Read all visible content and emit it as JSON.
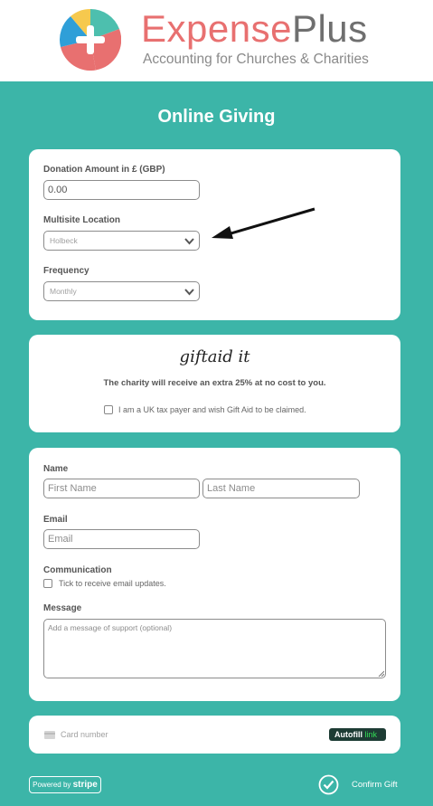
{
  "header": {
    "brand_part1": "Expense",
    "brand_part2": "Plus",
    "tagline": "Accounting for Churches & Charities"
  },
  "page_title": "Online Giving",
  "donation": {
    "amount_label": "Donation Amount in £ (GBP)",
    "amount_value": "0.00",
    "location_label": "Multisite Location",
    "location_value": "Holbeck",
    "frequency_label": "Frequency",
    "frequency_value": "Monthly"
  },
  "gift_aid": {
    "logo_text": "giftaid it",
    "description": "The charity will receive an extra 25% at no cost to you.",
    "checkbox_label": "I am a UK tax payer and wish Gift Aid to be claimed.",
    "checked": false
  },
  "details": {
    "name_label": "Name",
    "first_name_placeholder": "First Name",
    "last_name_placeholder": "Last Name",
    "email_label": "Email",
    "email_placeholder": "Email",
    "communication_label": "Communication",
    "communication_checkbox_label": "Tick to receive email updates.",
    "communication_checked": false,
    "message_label": "Message",
    "message_placeholder": "Add a message of support (optional)"
  },
  "payment": {
    "card_placeholder": "Card number",
    "autofill_text": "Autofill",
    "link_text": "link"
  },
  "footer": {
    "powered_by": "Powered by",
    "stripe": "stripe",
    "confirm_label": "Confirm Gift"
  },
  "colors": {
    "background": "#3cb5a8",
    "brand_red": "#e87070",
    "brand_grey": "#6f6f6f",
    "link_green": "#33dd55"
  },
  "icons": {
    "logo": "expenseplus-logo-icon",
    "chevron": "chevron-down-icon",
    "arrow": "annotation-arrow-icon",
    "card": "credit-card-icon",
    "confirm": "checkmark-circle-icon"
  }
}
